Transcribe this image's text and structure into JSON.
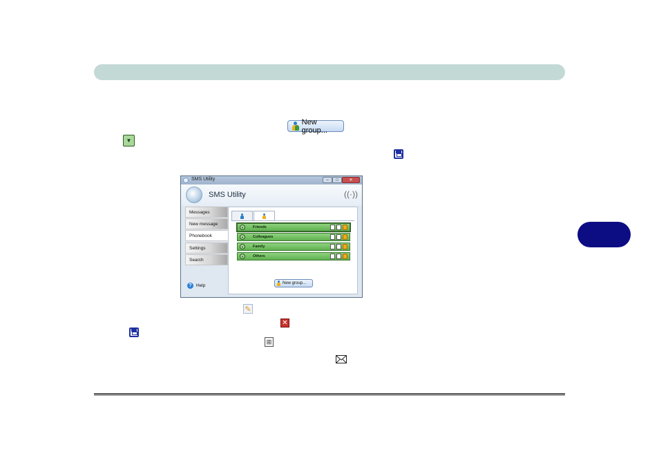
{
  "new_group_button": {
    "label": "New group..."
  },
  "window": {
    "title": "SMS Utility",
    "app_title": "SMS Utility",
    "controls": {
      "minimize": "–",
      "maximize": "□",
      "close": "✕"
    }
  },
  "sidebar": {
    "items": [
      {
        "label": "Messages"
      },
      {
        "label": "New message"
      },
      {
        "label": "Phonebook"
      },
      {
        "label": "Settings"
      },
      {
        "label": "Search"
      }
    ],
    "help_label": "Help"
  },
  "groups": [
    {
      "label": "Friends"
    },
    {
      "label": "Colleagues"
    },
    {
      "label": "Family"
    },
    {
      "label": "Others"
    }
  ],
  "colors": {
    "header_bar": "#c3d9d5",
    "chapter_tab": "#0c0d83",
    "group_green": "#6cbc5c"
  }
}
